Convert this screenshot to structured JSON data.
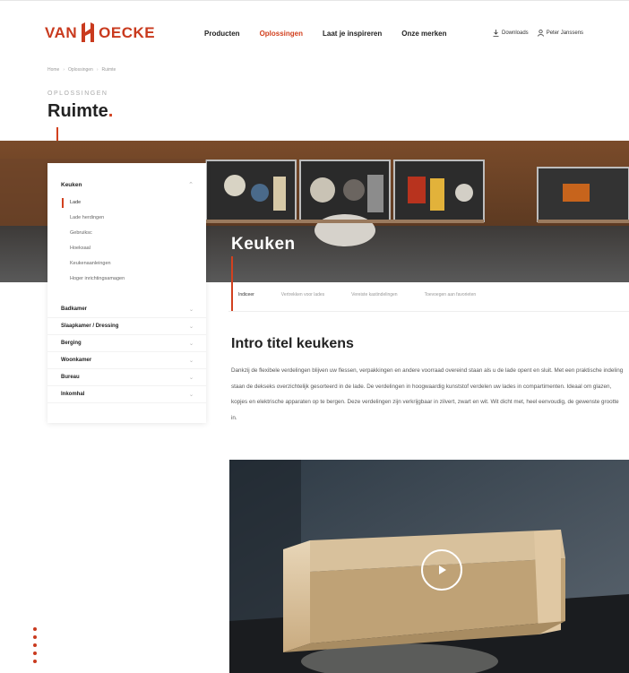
{
  "header": {
    "logo_left": "VAN",
    "logo_right": "OECKE",
    "nav": [
      {
        "label": "Producten"
      },
      {
        "label": "Oplossingen"
      },
      {
        "label": "Laat je inspireren"
      },
      {
        "label": "Onze merken"
      }
    ],
    "downloads_label": "Downloads",
    "user_label": "Peter Janssens"
  },
  "breadcrumb": [
    "Home",
    "Oplossingen",
    "Ruimte"
  ],
  "page": {
    "kicker": "Oplossingen",
    "title": "Ruimte",
    "title_dot": "."
  },
  "hero": {
    "title": "Keuken"
  },
  "sidebar": {
    "current_section": "Keuken",
    "sub_items": [
      {
        "label": "Lade"
      },
      {
        "label": "Lade herdingen"
      },
      {
        "label": "Gebruiksc"
      },
      {
        "label": "Hoeksaal"
      },
      {
        "label": "Keukenaanleingen"
      },
      {
        "label": "Hoger inrichtingsamagen"
      }
    ],
    "categories": [
      {
        "label": "Badkamer"
      },
      {
        "label": "Slaapkamer / Dressing"
      },
      {
        "label": "Berging"
      },
      {
        "label": "Woonkamer"
      },
      {
        "label": "Bureau"
      },
      {
        "label": "Inkomhal"
      }
    ]
  },
  "tabs": [
    {
      "label": "Indiceer"
    },
    {
      "label": "Vertrekken voor lades"
    },
    {
      "label": "Vereiste kastindelingen"
    },
    {
      "label": "Toevoegen aan favorieten"
    }
  ],
  "content": {
    "intro_title": "Intro titel keukens",
    "intro_body": "Dankzij de flexibele verdelingen blijven uw flessen, verpakkingen en andere voorraad overeind staan als u de lade opent en sluit. Met een praktische indeling staan de dekseks overzichtelijk gesorteerd in de lade. De verdelingen in hoogwaardig kunststof verdelen uw lades in compartimenten. Ideaal om glazen, kopjes en elektrische apparaten op te bergen. Deze verdelingen zijn verkrijgbaar in zilvert, zwart en wit. Wit dicht met, heel eenvoudig, de gewenste grootte in."
  },
  "colors": {
    "accent": "#d2411f",
    "brand": "#c93a1e"
  }
}
